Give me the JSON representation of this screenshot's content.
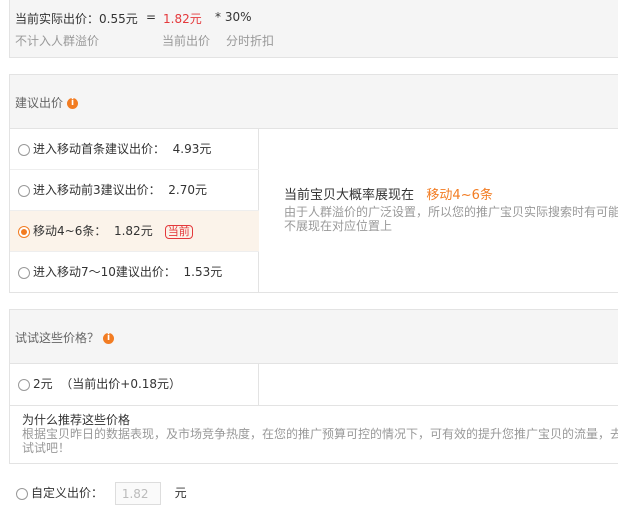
{
  "summary": {
    "actual_label": "当前实际出价：0.55元",
    "equals": "=",
    "current_price": "1.82元",
    "multiplier": "* 30%",
    "actual_note": "不计入人群溢价",
    "current_note": "当前出价",
    "discount_note": "分时折扣"
  },
  "suggested": {
    "title": "建议出价",
    "options": [
      {
        "label": "进入移动首条建议出价：",
        "price": "4.93元",
        "selected": false
      },
      {
        "label": "进入移动前3建议出价：",
        "price": "2.70元",
        "selected": false
      },
      {
        "label": "移动4~6条：",
        "price": "1.82元",
        "selected": true,
        "tag": "当前"
      },
      {
        "label": "进入移动7～10建议出价：",
        "price": "1.53元",
        "selected": false
      }
    ],
    "detail_prefix": "当前宝贝大概率展现在",
    "detail_position": "移动4~6条",
    "detail_note": "由于人群溢价的广泛设置，所以您的推广宝贝实际搜索时有可能不展现在对应位置上"
  },
  "try": {
    "title": "试试这些价格？",
    "option_price": "2元",
    "option_note": "（当前出价+0.18元）",
    "why_title": "为什么推荐这些价格",
    "why_text": "根据宝贝昨日的数据表现，及市场竞争热度，在您的推广预算可控的情况下，可有效的提升您推广宝贝的流量，去试试吧！"
  },
  "custom": {
    "label": "自定义出价：",
    "value": "1.82",
    "unit": "元"
  }
}
